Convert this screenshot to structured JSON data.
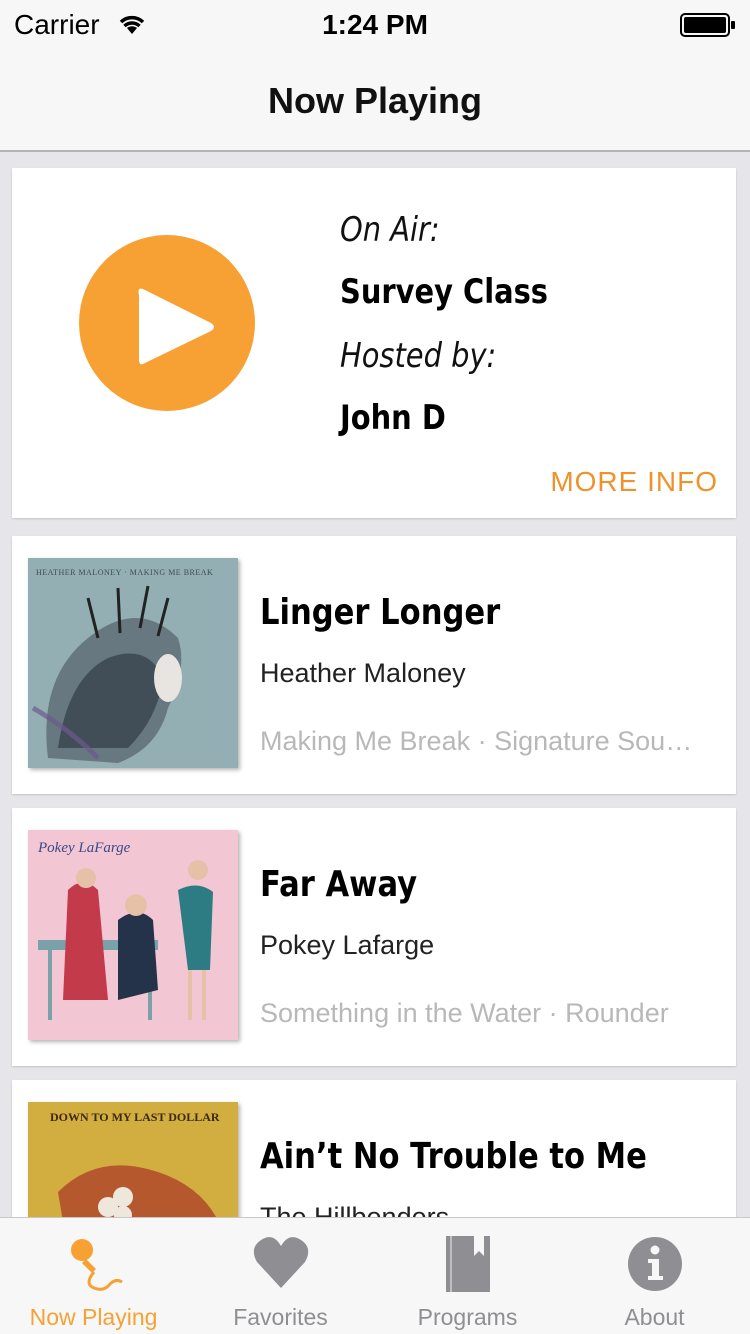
{
  "status_bar": {
    "carrier": "Carrier",
    "time": "1:24 PM"
  },
  "nav": {
    "title": "Now Playing"
  },
  "on_air": {
    "on_air_label": "On Air:",
    "program": "Survey Class",
    "hosted_label": "Hosted by:",
    "host": "John D",
    "more_info": "MORE INFO",
    "accent_color": "#f7a135"
  },
  "tracks": [
    {
      "title": "Linger Longer",
      "artist": "Heather Maloney",
      "meta": "Making Me Break · Signature Sou…",
      "art_text": "HEATHER MALONEY · MAKING ME BREAK"
    },
    {
      "title": "Far Away",
      "artist": "Pokey Lafarge",
      "meta": "Something in the Water · Rounder",
      "art_text": "Pokey LaFarge"
    },
    {
      "title": "Ain’t No Trouble to Me",
      "artist": "The Hillbenders",
      "meta": "",
      "art_text": "DOWN TO MY LAST DOLLAR"
    }
  ],
  "tabs": [
    {
      "label": "Now Playing",
      "icon": "microphone-icon",
      "active": true
    },
    {
      "label": "Favorites",
      "icon": "heart-icon",
      "active": false
    },
    {
      "label": "Programs",
      "icon": "notebook-icon",
      "active": false
    },
    {
      "label": "About",
      "icon": "info-icon",
      "active": false
    }
  ]
}
